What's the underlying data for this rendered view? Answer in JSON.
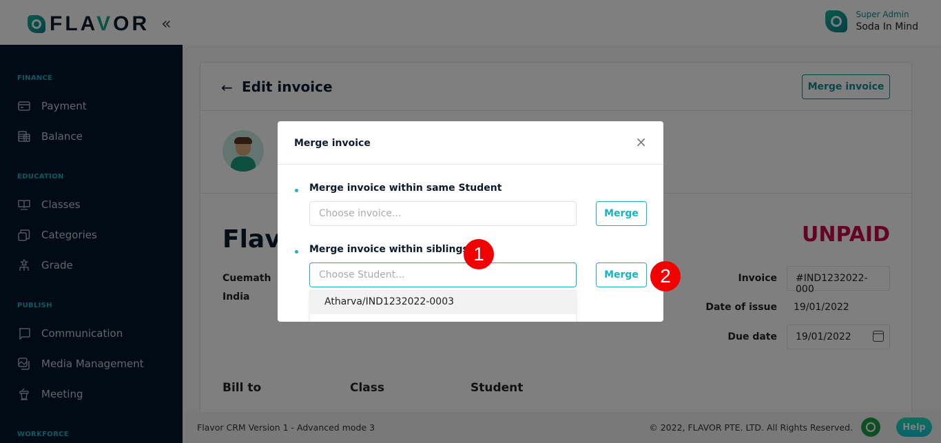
{
  "header": {
    "logo_text_a": "FLA",
    "logo_text_v": "V",
    "logo_text_b": "OR",
    "collapse_icon": "«",
    "user_role": "Super Admin",
    "user_name": "Soda In Mind"
  },
  "sidebar": {
    "sections": [
      {
        "title": "FINANCE",
        "items": [
          {
            "label": "Payment",
            "icon": "card-icon"
          },
          {
            "label": "Balance",
            "icon": "ledger-icon"
          }
        ]
      },
      {
        "title": "EDUCATION",
        "items": [
          {
            "label": "Classes",
            "icon": "book-icon"
          },
          {
            "label": "Categories",
            "icon": "stack-icon"
          },
          {
            "label": "Grade",
            "icon": "hierarchy-icon"
          }
        ]
      },
      {
        "title": "PUBLISH",
        "items": [
          {
            "label": "Communication",
            "icon": "chat-icon"
          },
          {
            "label": "Media Management",
            "icon": "image-icon"
          },
          {
            "label": "Meeting",
            "icon": "podium-icon"
          }
        ]
      },
      {
        "title": "WORKFORCE",
        "items": []
      }
    ]
  },
  "page": {
    "back_icon": "←",
    "title": "Edit invoice",
    "merge_invoice_button": "Merge invoice",
    "company_name": "Flavor",
    "address_line1": "Cuemath",
    "address_line2": "India",
    "status": "UNPAID",
    "invoice_label": "Invoice",
    "invoice_value": "#IND1232022-000",
    "issue_label": "Date of issue",
    "issue_value": "19/01/2022",
    "due_label": "Due date",
    "due_value": "19/01/2022",
    "columns": [
      "Bill to",
      "Class",
      "Student"
    ]
  },
  "modal": {
    "title": "Merge invoice",
    "close_icon": "×",
    "option1": {
      "label": "Merge invoice within same Student",
      "placeholder": "Choose invoice...",
      "button": "Merge"
    },
    "option2": {
      "label": "Merge invoice within siblings",
      "placeholder": "Choose Student...",
      "button": "Merge",
      "dropdown_options": [
        "Atharva/IND1232022-0003"
      ]
    }
  },
  "markers": [
    "1",
    "2"
  ],
  "footer": {
    "version": "Flavor CRM Version 1 - Advanced mode 3",
    "copyright": "© 2022, FLAVOR PTE. LTD. All Rights Reserved.",
    "help": "Help"
  },
  "colors": {
    "accent": "#17b3c4",
    "brand_teal": "#138b94",
    "status_unpaid": "#c8084a",
    "sidebar_bg": "#03172b",
    "marker": "#f20000"
  }
}
